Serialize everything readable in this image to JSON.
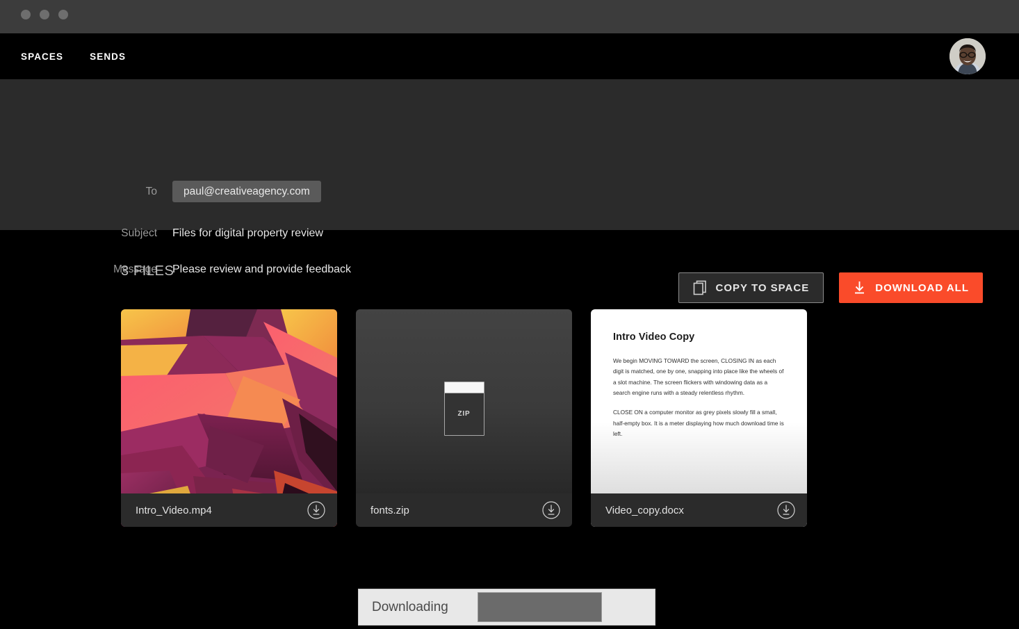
{
  "window": {
    "dots": [
      "close-dot",
      "minimize-dot",
      "maximize-dot"
    ]
  },
  "nav": {
    "links": [
      {
        "label": "SPACES",
        "name": "nav-link-spaces"
      },
      {
        "label": "SENDS",
        "name": "nav-link-sends"
      }
    ],
    "avatar_alt": "user-avatar"
  },
  "info": {
    "to": {
      "label": "To",
      "value": "paul@creativeagency.com"
    },
    "subject": {
      "label": "Subject",
      "value": "Files for digital property review"
    },
    "message": {
      "label": "Message",
      "value": "Please review and provide feedback"
    }
  },
  "actions": {
    "copy_to_space": "COPY TO SPACE",
    "download_all": "DOWNLOAD ALL"
  },
  "files": {
    "heading": "3 FILES",
    "count": 3,
    "items": [
      {
        "name": "Intro_Video.mp4",
        "type": "video",
        "thumbnail": "abstract-polygon-art"
      },
      {
        "name": "fonts.zip",
        "type": "archive",
        "thumbnail": "zip-icon",
        "icon_label": "ZIP"
      },
      {
        "name": "Video_copy.docx",
        "type": "document",
        "thumbnail": "document-preview"
      }
    ]
  },
  "document_preview": {
    "title": "Intro Video Copy",
    "paragraphs": [
      "We begin MOVING TOWARD the screen, CLOSING IN as each digit is matched, one by one, snapping into place like the wheels of a slot machine. The screen flickers with windowing data as a search engine runs with a steady relentless rhythm.",
      "CLOSE ON a computer monitor as grey pixels slowly fill a small, half-empty box. It is a meter displaying how much download time is left."
    ]
  },
  "toast": {
    "label": "Downloading",
    "progress_percent": 70
  },
  "colors": {
    "accent": "#fa4b2a",
    "titlebar": "#3c3c3c",
    "panel": "#2b2b2b",
    "background": "#000000"
  }
}
